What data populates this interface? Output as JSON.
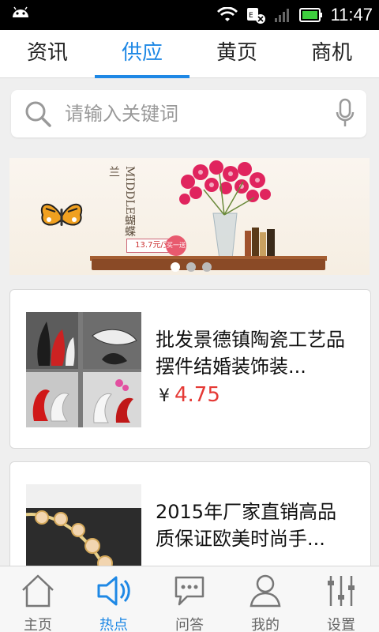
{
  "status_bar": {
    "time": "11:47"
  },
  "tabs": [
    {
      "label": "资讯",
      "active": false
    },
    {
      "label": "供应",
      "active": true
    },
    {
      "label": "黄页",
      "active": false
    },
    {
      "label": "商机",
      "active": false
    }
  ],
  "search": {
    "placeholder": "请输入关键词"
  },
  "banner": {
    "vertical_text": "MIDDLE蝴蝶兰",
    "price_text": "13.7元/支",
    "badge_text": "买一送一",
    "dots": 3,
    "active_dot": 0
  },
  "products": [
    {
      "title": "批发景德镇陶瓷工艺品摆件结婚装饰装...",
      "currency": "¥",
      "price": "4.75"
    },
    {
      "title": "2015年厂家直销高品质保证欧美时尚手...",
      "currency": "",
      "price": ""
    }
  ],
  "bottom_nav": [
    {
      "label": "主页",
      "icon": "home-icon",
      "active": false
    },
    {
      "label": "热点",
      "icon": "speaker-icon",
      "active": true
    },
    {
      "label": "问答",
      "icon": "chat-icon",
      "active": false
    },
    {
      "label": "我的",
      "icon": "user-icon",
      "active": false
    },
    {
      "label": "设置",
      "icon": "sliders-icon",
      "active": false
    }
  ],
  "colors": {
    "accent": "#1e88e5",
    "price": "#e53935"
  }
}
